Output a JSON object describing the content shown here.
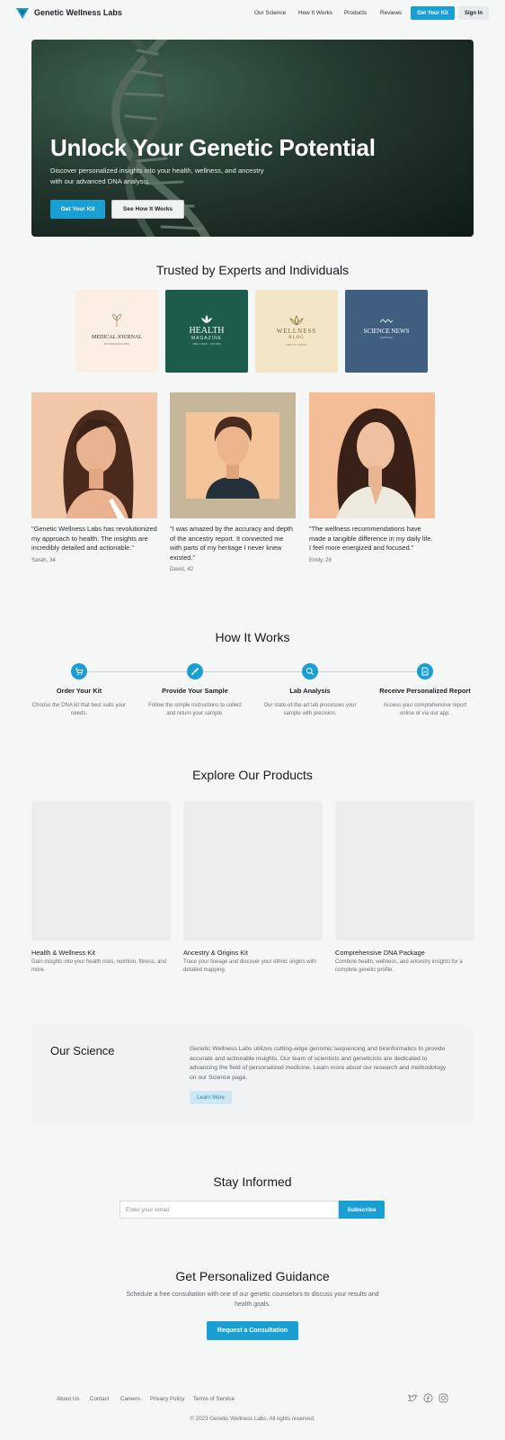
{
  "header": {
    "brand": "Genetic Wellness Labs",
    "nav": [
      "Our Science",
      "How It Works",
      "Products",
      "Reviews"
    ],
    "cta": "Get Your Kit",
    "signin": "Sign In"
  },
  "hero": {
    "title": "Unlock Your Genetic Potential",
    "subtitle": "Discover personalized insights into your health, wellness, and ancestry with our advanced DNA analysis.",
    "primary_button": "Get Your Kit",
    "secondary_button": "See How It Works"
  },
  "trusted": {
    "title": "Trusted by Experts and Individuals",
    "logos": [
      {
        "name": "MEDICAL JOURNAL",
        "tagline": "ESTABLISHED 2023",
        "bg": "#fbefe4"
      },
      {
        "name": "HEALTH",
        "name2": "MAGAZINE",
        "tagline": "WELLNESS · NATURE",
        "bg": "#1d5b4b"
      },
      {
        "name": "WELLNESS",
        "name2": "BLOG",
        "tagline": "HEALTH & MIND",
        "bg": "#f3e6c6"
      },
      {
        "name": "SCIENCE NEWS",
        "tagline": "NATIONAL",
        "bg": "#3f5e80"
      }
    ]
  },
  "testimonials": [
    {
      "quote": "\"Genetic Wellness Labs has revolutionized my approach to health. The insights are incredibly detailed and actionable.\"",
      "author": "Sarah, 34"
    },
    {
      "quote": "\"I was amazed by the accuracy and depth of the ancestry report. It connected me with parts of my heritage I never knew existed.\"",
      "author": "David, 42"
    },
    {
      "quote": "\"The wellness recommendations have made a tangible difference in my daily life. I feel more energized and focused.\"",
      "author": "Emily, 28"
    }
  ],
  "how_it_works": {
    "title": "How It Works",
    "steps": [
      {
        "icon": "cart-icon",
        "title": "Order Your Kit",
        "desc": "Choose the DNA kit that best suits your needs."
      },
      {
        "icon": "swab-icon",
        "title": "Provide Your Sample",
        "desc": "Follow the simple instructions to collect and return your sample."
      },
      {
        "icon": "magnify-icon",
        "title": "Lab Analysis",
        "desc": "Our state-of-the-art lab processes your sample with precision."
      },
      {
        "icon": "report-icon",
        "title": "Receive Personalized Report",
        "desc": "Access your comprehensive report online or via our app."
      }
    ]
  },
  "products": {
    "title": "Explore Our Products",
    "items": [
      {
        "name": "Health & Wellness Kit",
        "desc": "Gain insights into your health risks, nutrition, fitness, and more."
      },
      {
        "name": "Ancestry & Origins Kit",
        "desc": "Trace your lineage and discover your ethnic origins with detailed mapping."
      },
      {
        "name": "Comprehensive DNA Package",
        "desc": "Combine health, wellness, and ancestry insights for a complete genetic profile."
      }
    ]
  },
  "science": {
    "title": "Our Science",
    "text": "Genetic Wellness Labs utilizes cutting-edge genomic sequencing and bioinformatics to provide accurate and actionable insights. Our team of scientists and geneticists are dedicated to advancing the field of personalized medicine. Learn more about our research and methodology on our Science page.",
    "button": "Learn More"
  },
  "newsletter": {
    "title": "Stay Informed",
    "placeholder": "Enter your email",
    "button": "Subscribe"
  },
  "guidance": {
    "title": "Get Personalized Guidance",
    "desc": "Schedule a free consultation with one of our genetic counselors to discuss your results and health goals.",
    "button": "Request a Consultation"
  },
  "footer": {
    "links": [
      "About Us",
      "Contact",
      "Careers",
      "Privacy Policy",
      "Terms of Service"
    ],
    "social": [
      "twitter-icon",
      "facebook-icon",
      "instagram-icon"
    ],
    "copyright": "© 2023 Genetic Wellness Labs. All rights reserved."
  },
  "colors": {
    "accent": "#1a9fd4",
    "background": "#f5f6f6",
    "text": "#1c2126"
  }
}
